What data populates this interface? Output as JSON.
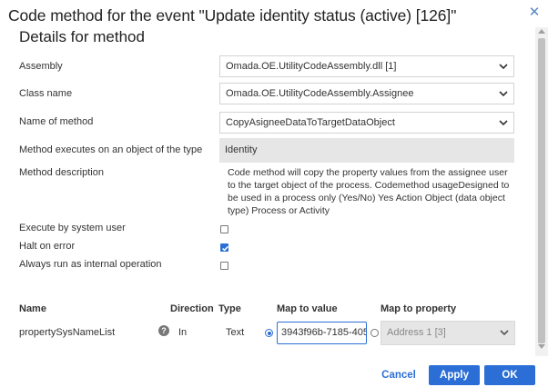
{
  "dialog": {
    "title": "Code method for the event \"Update identity status (active) [126]\"",
    "close_icon": "close-icon"
  },
  "details": {
    "section_title": "Details for method",
    "assembly": {
      "label": "Assembly",
      "value": "Omada.OE.UtilityCodeAssembly.dll [1]"
    },
    "class_name": {
      "label": "Class name",
      "value": "Omada.OE.UtilityCodeAssembly.Assignee"
    },
    "method_name": {
      "label": "Name of method",
      "value": "CopyAsigneeDataToTargetDataObject"
    },
    "object_type": {
      "label": "Method executes on an object of the type",
      "value": "Identity"
    },
    "description": {
      "label": "Method description",
      "value": "Code method will copy the property values from the assignee user to the target object of the process. Codemethod usageDesigned to be used in a process only (Yes/No) Yes Action Object (data object type) Process or Activity"
    },
    "execute_by_system_user": {
      "label": "Execute by system user",
      "checked": false
    },
    "halt_on_error": {
      "label": "Halt on error",
      "checked": true
    },
    "always_internal": {
      "label": "Always run as internal operation",
      "checked": false
    }
  },
  "parameters": {
    "headers": {
      "name": "Name",
      "direction": "Direction",
      "type": "Type",
      "map_to_value": "Map to value",
      "map_to_property": "Map to property"
    },
    "rows": [
      {
        "name": "propertySysNameList",
        "help_icon": "question-circle-icon",
        "help_symbol": "?",
        "direction": "In",
        "type": "Text",
        "map_to_value_selected": true,
        "map_to_value": "3943f96b-7185-405",
        "map_to_property_selected": false,
        "map_to_property": "Address 1 [3]"
      }
    ]
  },
  "footer": {
    "cancel_label": "Cancel",
    "apply_label": "Apply",
    "ok_label": "OK"
  },
  "colors": {
    "accent": "#2b6fd6",
    "readonly_bg": "#e6e6e6"
  }
}
